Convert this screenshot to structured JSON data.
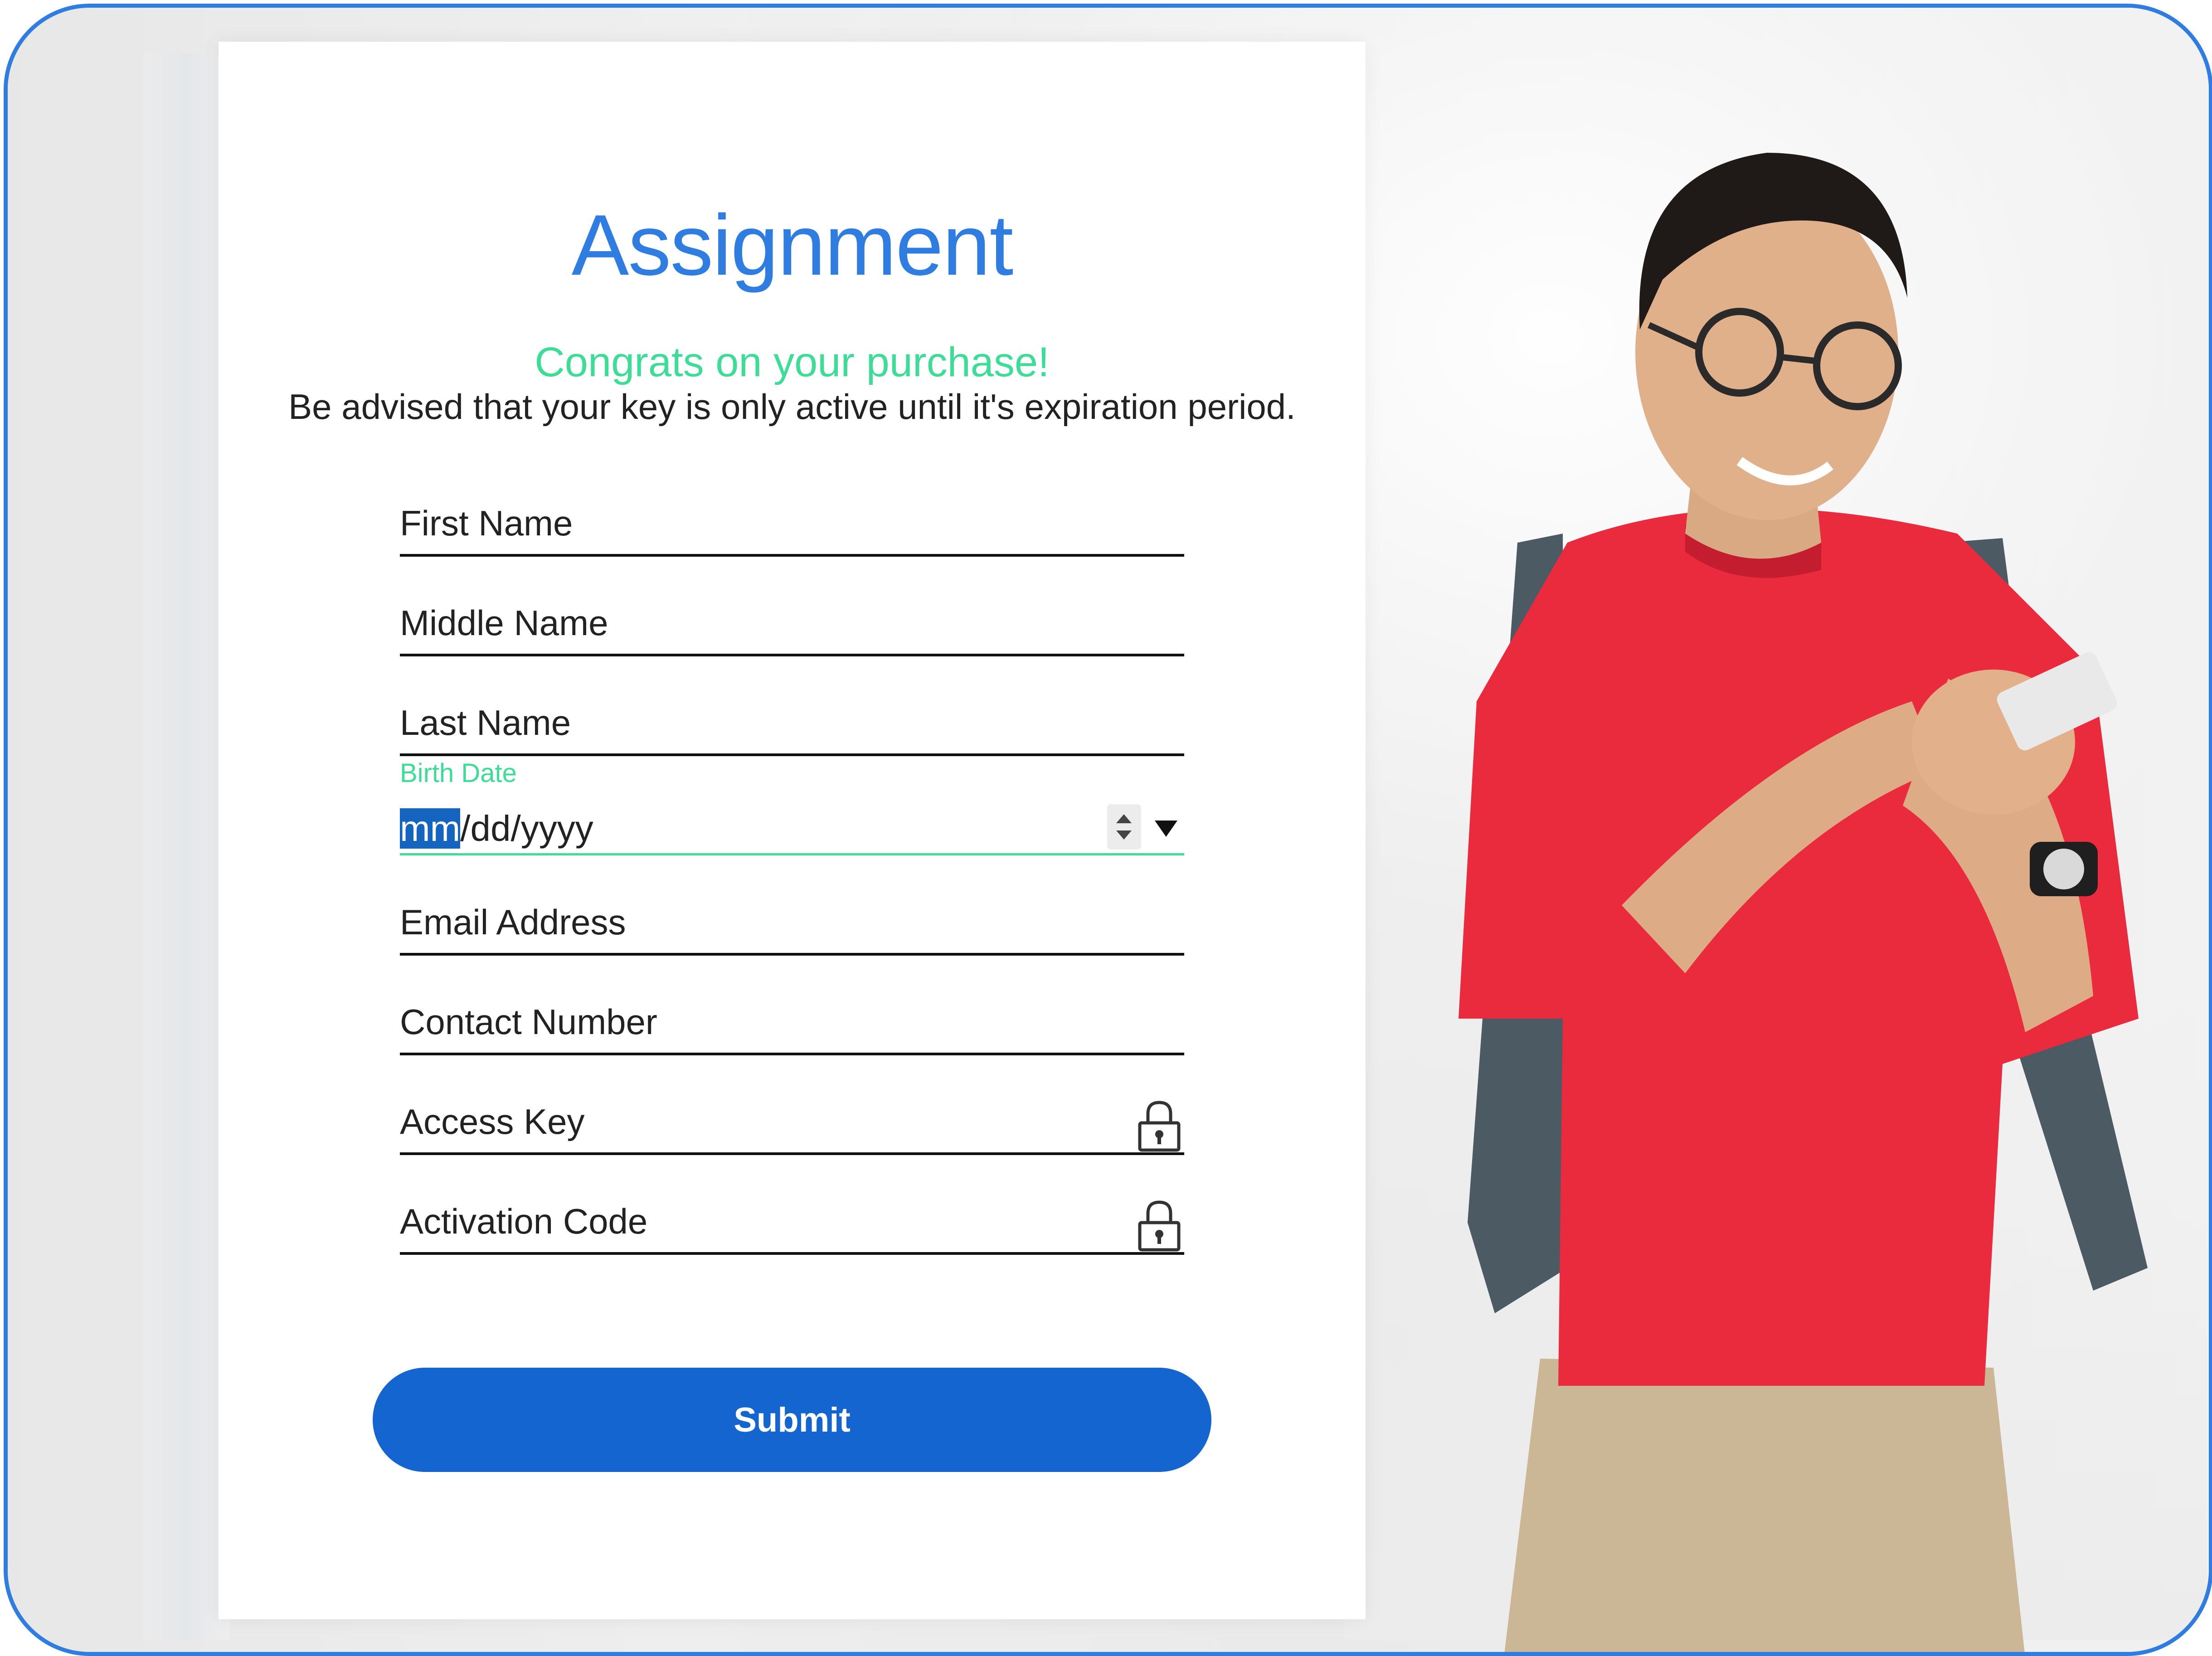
{
  "form": {
    "title": "Assignment",
    "congrats": "Congrats on your purchase!",
    "advice": "Be advised that your key is only active until it's expiration period.",
    "fields": {
      "first_name": "First Name",
      "middle_name": "Middle Name",
      "last_name": "Last Name",
      "birth_date_label": "Birth Date",
      "birth_date_mm": "mm",
      "birth_date_rest": "/dd/yyyy",
      "email": "Email Address",
      "contact": "Contact Number",
      "access_key": "Access Key",
      "activation_code": "Activation Code"
    },
    "submit_label": "Submit"
  },
  "icons": {
    "lock": "lock-icon",
    "spinner": "spinner-arrows-icon",
    "dropdown": "caret-down-icon"
  },
  "colors": {
    "accent_blue": "#2f7de0",
    "button_blue": "#1565d0",
    "success_green": "#3ddc97",
    "frame_border": "#2f7de0"
  }
}
